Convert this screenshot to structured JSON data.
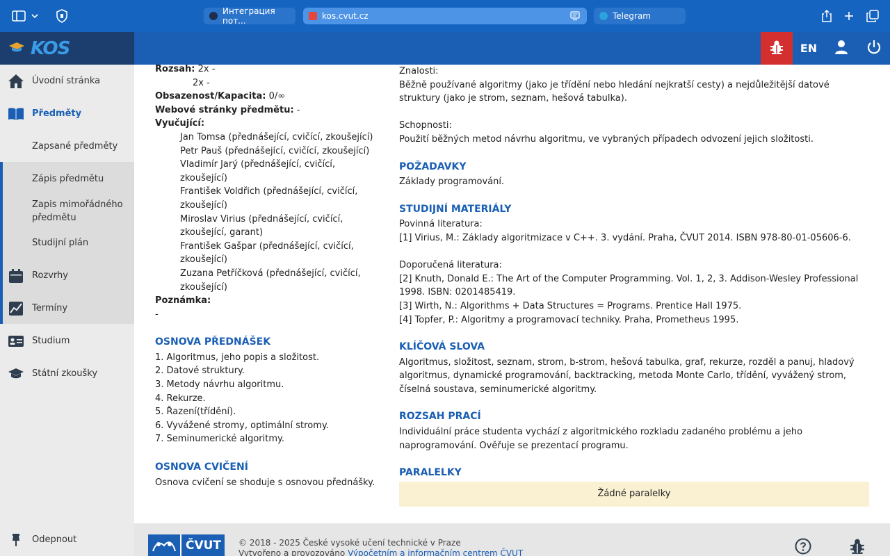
{
  "browser": {
    "tabs": [
      {
        "label": "Интеграция пот...",
        "favicon_color": "#1e2d4a"
      },
      {
        "label": "kos.cvut.cz",
        "favicon_color": "#e8453c"
      },
      {
        "label": "Telegram",
        "favicon_color": "#2aa3de"
      }
    ]
  },
  "header": {
    "logo": "KOS",
    "lang_label": "EN"
  },
  "sidebar": {
    "items": [
      {
        "label": "Úvodní stránka",
        "icon": "home-icon"
      },
      {
        "label": "Předměty",
        "icon": "book-icon"
      },
      {
        "label": "Zapsané předměty"
      },
      {
        "label": "Zápis předmětu"
      },
      {
        "label": "Zapis mimořádného předmětu"
      },
      {
        "label": "Studijní plán"
      },
      {
        "label": "Rozvrhy",
        "icon": "calendar-icon"
      },
      {
        "label": "Termíny",
        "icon": "chart-icon"
      },
      {
        "label": "Studium",
        "icon": "id-card-icon"
      },
      {
        "label": "Státní zkoušky",
        "icon": "graduation-cap-icon"
      }
    ],
    "unpin_label": "Odepnout"
  },
  "left": {
    "rozsah_label": "Rozsah:",
    "rozsah_value1": "2x -",
    "rozsah_value2": "2x -",
    "kapacita_label": "Obsazenost/Kapacita:",
    "kapacita_value": "0/∞",
    "web_label": "Webové stránky předmětu:",
    "web_value": "-",
    "vyucujici_label": "Vyučující:",
    "teachers": [
      {
        "name": "Jan Tomsa",
        "roles": "(přednášející, cvičící, zkoušející)"
      },
      {
        "name": "Petr Pauš",
        "roles": "(přednášející, cvičící, zkoušející)"
      },
      {
        "name": "Vladimír Jarý",
        "roles": "(přednášející, cvičící, zkoušející)"
      },
      {
        "name": "František Voldřich",
        "roles": "(přednášející, cvičící, zkoušející)"
      },
      {
        "name": "Miroslav Virius",
        "roles": "(přednášející, cvičící, zkoušející, garant)"
      },
      {
        "name": "František Gašpar",
        "roles": "(přednášející, cvičící, zkoušející)"
      },
      {
        "name": "Zuzana Petříčková",
        "roles": "(přednášející, cvičící, zkoušející)"
      }
    ],
    "poznamka_label": "Poznámka:",
    "poznamka_value": "-",
    "osnova_prednasek_title": "OSNOVA PŘEDNÁŠEK",
    "osnova_prednasek": [
      "1. Algoritmus, jeho popis a složitost.",
      "2. Datové struktury.",
      "3. Metody návrhu algoritmu.",
      "4. Rekurze.",
      "5. Řazení(třídění).",
      "6. Vyvážené stromy, optimální stromy.",
      "7. Seminumerické algoritmy."
    ],
    "osnova_cviceni_title": "OSNOVA CVIČENÍ",
    "osnova_cviceni_text": "Osnova cvičení se shoduje s osnovou přednášky."
  },
  "right": {
    "znalosti_label": "Znalosti:",
    "znalosti_text": "Běžně používané algoritmy (jako je třídění nebo hledání nejkratší cesty) a nejdůležitější datové struktury (jako je strom, seznam, hešová tabulka).",
    "schopnosti_label": "Schopnosti:",
    "schopnosti_text": "Použití běžných metod návrhu algoritmu, ve vybraných případech odvození jejich složitosti.",
    "pozadavky_title": "POŽADAVKY",
    "pozadavky_text": "Základy programování.",
    "materialy_title": "STUDIJNÍ MATERIÁLY",
    "povinna_label": "Povinná literatura:",
    "povinna_items": [
      "[1] Virius, M.: Základy algoritmizace v C++. 3. vydání. Praha, ČVUT 2014. ISBN 978-80-01-05606-6."
    ],
    "doporucena_label": "Doporučená literatura:",
    "doporucena_items": [
      "[2] Knuth, Donald E.: The Art of the Computer Programming. Vol. 1, 2, 3. Addison-Wesley Professional 1998. ISBN: 0201485419.",
      "[3] Wirth, N.: Algorithms + Data Structures = Programs. Prentice Hall 1975.",
      "[4] Topfer, P.: Algoritmy a programovací techniky. Praha, Prometheus 1995."
    ],
    "klicova_title": "KLÍČOVÁ SLOVA",
    "klicova_text": "Algoritmus, složitost, seznam, strom, b-strom, hešová tabulka, graf, rekurze, rozděl a panuj, hladový algoritmus, dynamické programování, backtracking, metoda Monte Carlo, třídění, vyvážený strom, číselná soustava, seminumerické algoritmy.",
    "rozsah_praci_title": "ROZSAH PRACÍ",
    "rozsah_praci_text": "Individuální práce studenta vychází z algoritmického rozkladu zadaného problému a jeho naprogramování. Ověřuje se prezentací programu.",
    "paralelky_title": "PARALELKY",
    "paralelky_empty": "Žádné paralelky"
  },
  "footer": {
    "logo": "ČVUT",
    "copyright": "© 2018 - 2025 České vysoké učení technické v Praze",
    "created_prefix": "Vytvořeno a provozováno",
    "created_link": "Výpočetním a informačním centrem ČVUT"
  }
}
